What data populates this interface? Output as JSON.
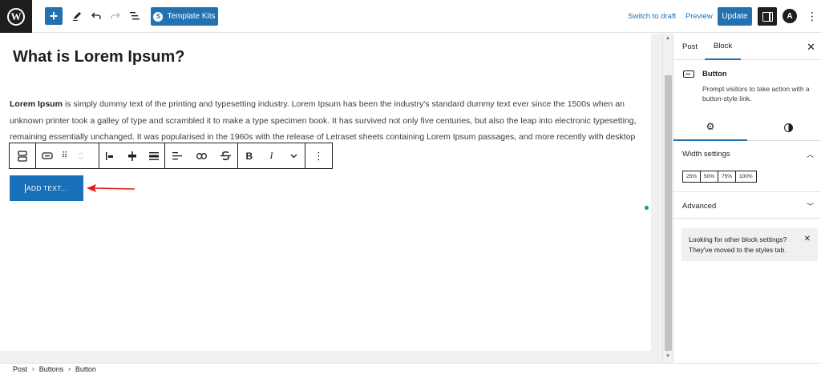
{
  "topbar": {
    "logo_letter": "W",
    "template_kits_label": "Template Kits",
    "switch_to_draft": "Switch to draft",
    "preview": "Preview",
    "update": "Update",
    "astra_letter": "A"
  },
  "content": {
    "heading": "What is Lorem Ipsum?",
    "para_bold": "Lorem Ipsum",
    "para_text": " is simply dummy text of the printing and typesetting industry. Lorem Ipsum has been the industry's standard dummy text ever since the 1500s when an unknown printer took a galley of type and scrambled it to make a type specimen book. It has survived not only five centuries, but also the leap into electronic typesetting, remaining essentially unchanged. It was popularised in the 1960s with the release of Letraset sheets containing Lorem Ipsum passages, and more recently with desktop publishing software like Aldus PageMaker including versions of Lorem Ipsum.",
    "button_text": "ADD TEXT..."
  },
  "block_toolbar": {
    "bold": "B",
    "italic": "I"
  },
  "sidebar": {
    "tab_post": "Post",
    "tab_block": "Block",
    "block_title": "Button",
    "block_description": "Prompt visitors to take action with a button-style link.",
    "width_settings": "Width settings",
    "width_options": [
      "25%",
      "50%",
      "75%",
      "100%"
    ],
    "advanced": "Advanced",
    "notice": "Looking for other block settings? They've moved to the styles tab."
  },
  "breadcrumb": [
    "Post",
    "Buttons",
    "Button"
  ],
  "colors": {
    "accent": "#2271b1",
    "button_bg": "#1870b8",
    "arrow": "#e01b1b",
    "dot": "#00a878"
  }
}
